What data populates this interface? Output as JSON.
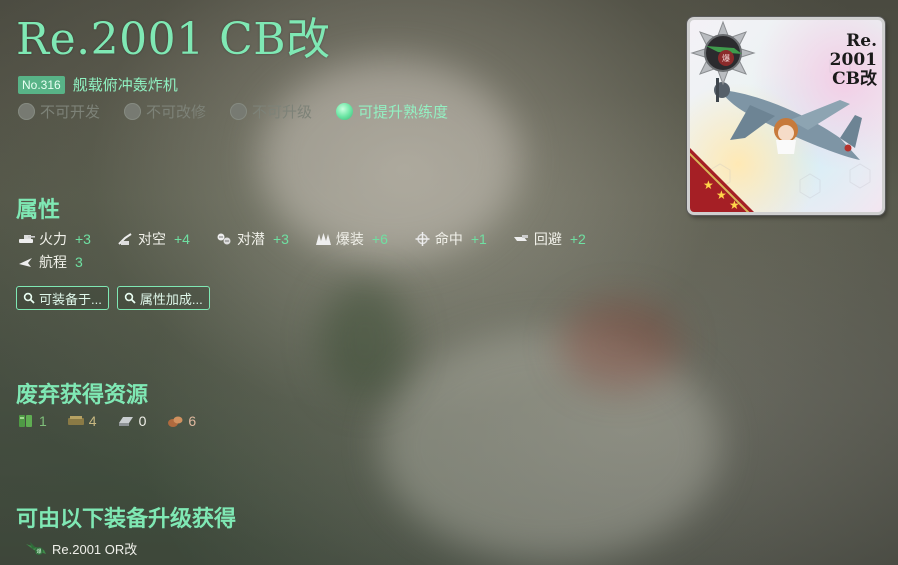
{
  "equipment": {
    "name": "Re.2001 CB改",
    "number_badge": "No.316",
    "type": "舰载俯冲轰炸机"
  },
  "flags": [
    {
      "label": "不可开发",
      "state": "off"
    },
    {
      "label": "不可改修",
      "state": "off"
    },
    {
      "label": "不可升级",
      "state": "off"
    },
    {
      "label": "可提升熟练度",
      "state": "on"
    }
  ],
  "stats_section": {
    "title": "属性",
    "rows": [
      [
        {
          "label": "火力",
          "value": "+3",
          "icon": "firepower-icon"
        },
        {
          "label": "对空",
          "value": "+4",
          "icon": "anti-air-icon"
        },
        {
          "label": "对潜",
          "value": "+3",
          "icon": "anti-submarine-icon"
        },
        {
          "label": "爆装",
          "value": "+6",
          "icon": "dive-bombing-icon"
        },
        {
          "label": "命中",
          "value": "+1",
          "icon": "accuracy-icon"
        },
        {
          "label": "回避",
          "value": "+2",
          "icon": "evasion-icon"
        }
      ],
      [
        {
          "label": "航程",
          "value": "3",
          "icon": "range-icon"
        }
      ]
    ],
    "buttons": {
      "equippable_by": "可装备于...",
      "stat_bonus": "属性加成..."
    }
  },
  "scrap_section": {
    "title": "废弃获得资源",
    "resources": [
      {
        "name": "fuel",
        "value": "1",
        "color": "#7fbf7a"
      },
      {
        "name": "ammo",
        "value": "4",
        "color": "#c9b982"
      },
      {
        "name": "steel",
        "value": "0",
        "color": "#f1f1ea"
      },
      {
        "name": "bauxite",
        "value": "6",
        "color": "#e0b9a0"
      }
    ]
  },
  "upgrade_section": {
    "title": "可由以下装备升级获得",
    "source_item": "Re.2001 OR改"
  },
  "card": {
    "label_lines": [
      "Re.",
      "2001",
      "CB改"
    ],
    "rarity_stars": 3,
    "emblem_text": "爆"
  },
  "colors": {
    "accent": "#7fe8b4",
    "stat_value": "#6fe0a2",
    "badge_bg": "#58b387"
  }
}
